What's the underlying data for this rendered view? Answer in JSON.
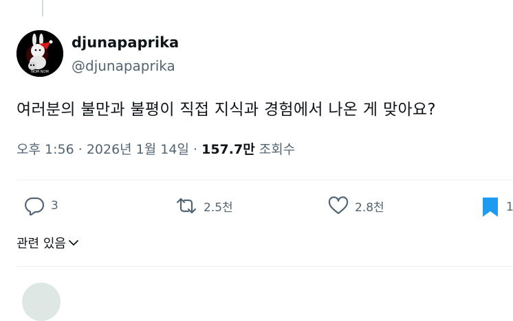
{
  "tweet": {
    "display_name": "djunapaprika",
    "handle": "@djunapaprika",
    "avatar_text": "NOM NOM",
    "text": "여러분의 불만과 불평이 직접 지식과 경험에서 나온 게 맞아요?",
    "time": "오후 1:56",
    "date": "2026년 1월 14일",
    "views_count": "157.7만",
    "views_label": "조회수"
  },
  "actions": {
    "reply_count": "3",
    "retweet_count": "2.5천",
    "like_count": "2.8천",
    "bookmark_count": "1"
  },
  "related": {
    "label": "관련 있음"
  },
  "colors": {
    "text": "#0f1419",
    "secondary": "#536471",
    "divider": "#eff3f4",
    "bookmark": "#1d9bf0"
  }
}
